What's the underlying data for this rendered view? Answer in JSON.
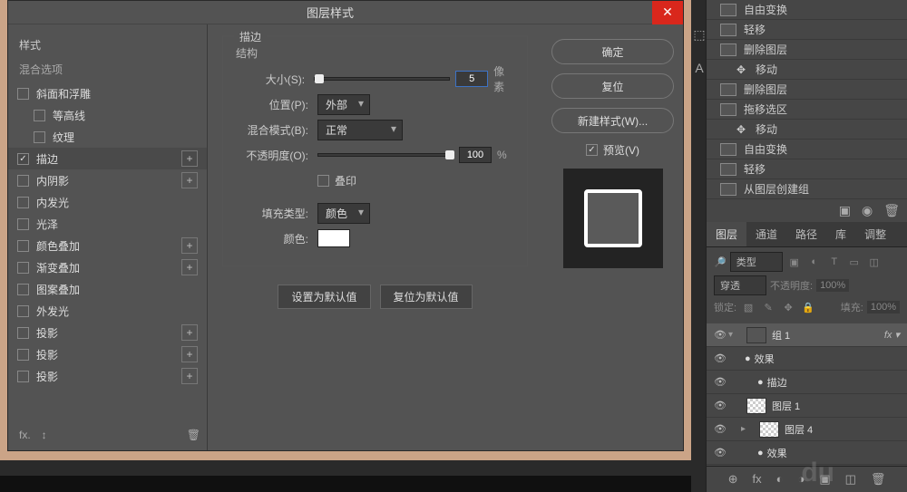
{
  "dialog": {
    "title": "图层样式",
    "styles_header": "样式",
    "blend_options": "混合选项",
    "style_items": [
      {
        "label": "斜面和浮雕",
        "checked": false,
        "add": false
      },
      {
        "label": "等高线",
        "checked": false,
        "add": false,
        "indent": true
      },
      {
        "label": "纹理",
        "checked": false,
        "add": false,
        "indent": true
      },
      {
        "label": "描边",
        "checked": true,
        "add": true,
        "active": true
      },
      {
        "label": "内阴影",
        "checked": false,
        "add": true
      },
      {
        "label": "内发光",
        "checked": false,
        "add": false
      },
      {
        "label": "光泽",
        "checked": false,
        "add": false
      },
      {
        "label": "颜色叠加",
        "checked": false,
        "add": true
      },
      {
        "label": "渐变叠加",
        "checked": false,
        "add": true
      },
      {
        "label": "图案叠加",
        "checked": false,
        "add": false
      },
      {
        "label": "外发光",
        "checked": false,
        "add": false
      },
      {
        "label": "投影",
        "checked": false,
        "add": true
      },
      {
        "label": "投影",
        "checked": false,
        "add": true
      },
      {
        "label": "投影",
        "checked": false,
        "add": true
      }
    ],
    "fx_label": "fx.",
    "stroke": {
      "legend": "描边",
      "sublegend": "结构",
      "size_label": "大小(S):",
      "size_value": "5",
      "size_unit": "像素",
      "position_label": "位置(P):",
      "position_value": "外部",
      "blend_label": "混合模式(B):",
      "blend_value": "正常",
      "opacity_label": "不透明度(O):",
      "opacity_value": "100",
      "opacity_unit": "%",
      "overprint_label": "叠印",
      "fill_type_label": "填充类型:",
      "fill_type_value": "颜色",
      "color_label": "颜色:",
      "color_value": "#ffffff"
    },
    "defaults": {
      "set": "设置为默认值",
      "reset": "复位为默认值"
    },
    "actions": {
      "ok": "确定",
      "reset": "复位",
      "new_style": "新建样式(W)...",
      "preview": "预览(V)"
    }
  },
  "history": [
    {
      "label": "自由变换",
      "icon": "doc"
    },
    {
      "label": "轻移",
      "icon": "doc"
    },
    {
      "label": "删除图层",
      "icon": "doc"
    },
    {
      "label": "移动",
      "icon": "move",
      "indent": true
    },
    {
      "label": "删除图层",
      "icon": "doc"
    },
    {
      "label": "拖移选区",
      "icon": "doc"
    },
    {
      "label": "移动",
      "icon": "move",
      "indent": true
    },
    {
      "label": "自由变换",
      "icon": "doc"
    },
    {
      "label": "轻移",
      "icon": "doc"
    },
    {
      "label": "从图层创建组",
      "icon": "doc"
    }
  ],
  "layers_panel": {
    "tabs": [
      "图层",
      "通道",
      "路径",
      "库",
      "调整"
    ],
    "type_label": "类型",
    "blend_mode": "穿透",
    "opacity_label": "不透明度:",
    "opacity_value": "100%",
    "lock_label": "锁定:",
    "fill_label": "填充:",
    "fill_value": "100%",
    "layers": [
      {
        "name": "组 1",
        "type": "folder",
        "selected": true,
        "fx": "fx",
        "indent": 0,
        "chevron": "▾"
      },
      {
        "name": "效果",
        "type": "fx",
        "indent": 1,
        "eye": true
      },
      {
        "name": "描边",
        "type": "fx",
        "indent": 2,
        "eye": true
      },
      {
        "name": "图层 1",
        "type": "layer",
        "indent": 1,
        "eye": true
      },
      {
        "name": "图层 4",
        "type": "layer",
        "indent": 1,
        "eye": true,
        "chevron": "▸"
      },
      {
        "name": "效果",
        "type": "fx",
        "indent": 2,
        "eye": true
      }
    ]
  },
  "watermark": "du"
}
